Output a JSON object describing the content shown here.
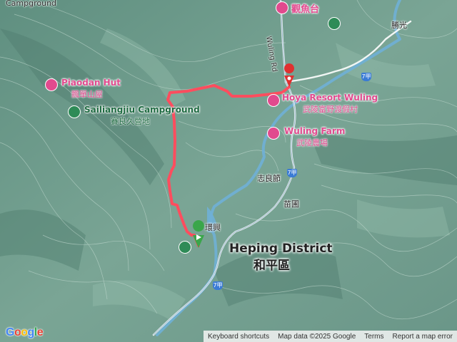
{
  "map": {
    "top_label": "Campground",
    "places": {
      "guanyutai": "觀魚台",
      "wuling_road": "Wuling Rd",
      "shengguang": "勝光",
      "piaodan_hut_en": "Piaodan Hut",
      "piaodan_hut_zh": "飄單山屋",
      "sailiangjiu_en": "Sailiangjiu Campground",
      "sailiangjiu_zh": "賽良久營地",
      "hoya_en": "Hoya Resort Wuling",
      "hoya_zh": "武陵富野渡假村",
      "wuling_farm_en": "Wuling Farm",
      "wuling_farm_zh": "武陵農場",
      "zhiliangjie": "志良節",
      "miaopu": "苗圃",
      "huanshan": "環興",
      "heping_en": "Heping District",
      "heping_zh": "和平區"
    },
    "road_shields": [
      "7甲",
      "7甲",
      "7甲"
    ],
    "icons": {
      "lodging": "hotel-icon",
      "camp": "campground-icon",
      "park": "park-icon",
      "start": "start-marker-icon",
      "end": "end-marker-icon"
    },
    "colors": {
      "terrain": "#6f9b8d",
      "track": "#ff4d5e",
      "poi": "#e14a8e",
      "park": "#2e8b57",
      "water": "#6fb0d6"
    }
  },
  "attribution": {
    "logo": "Google",
    "keyboard": "Keyboard shortcuts",
    "map_data": "Map data ©2025 Google",
    "terms": "Terms",
    "report": "Report a map error"
  }
}
